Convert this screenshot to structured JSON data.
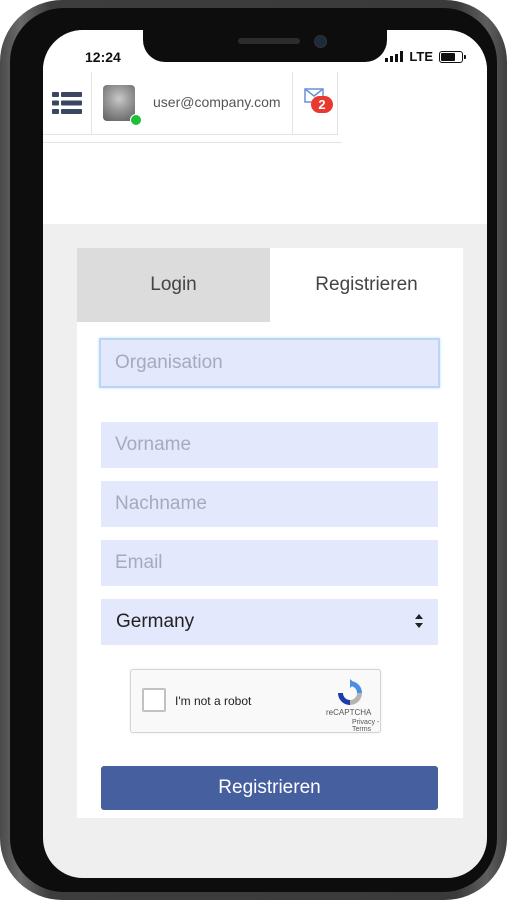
{
  "status_bar": {
    "time": "12:24",
    "network": "LTE"
  },
  "header": {
    "user_email": "user@company.com",
    "message_count": "2"
  },
  "tabs": [
    {
      "label": "Login",
      "active": false
    },
    {
      "label": "Registrieren",
      "active": true
    }
  ],
  "form": {
    "organisation_placeholder": "Organisation",
    "firstname_placeholder": "Vorname",
    "lastname_placeholder": "Nachname",
    "email_placeholder": "Email",
    "country_selected": "Germany",
    "submit_label": "Registrieren"
  },
  "captcha": {
    "label": "I'm not a robot",
    "brand": "reCAPTCHA",
    "privacy": "Privacy",
    "separator": "-",
    "terms": "Terms"
  },
  "colors": {
    "accent": "#46609f",
    "field_background": "#e4e8fd",
    "badge": "#e8382f",
    "online": "#1fbf3a"
  },
  "icons": [
    "menu-icon",
    "envelope-icon",
    "select-arrows-icon",
    "recaptcha-logo-icon"
  ]
}
